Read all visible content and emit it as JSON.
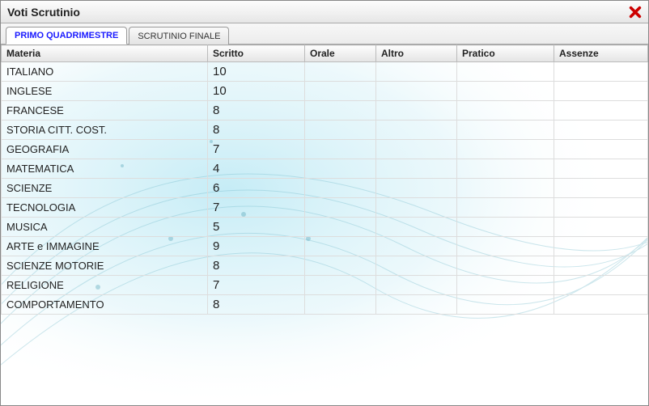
{
  "window": {
    "title": "Voti Scrutinio"
  },
  "tabs": [
    {
      "label": "PRIMO QUADRIMESTRE",
      "active": true
    },
    {
      "label": "SCRUTINIO FINALE",
      "active": false
    }
  ],
  "columns": {
    "materia": "Materia",
    "scritto": "Scritto",
    "orale": "Orale",
    "altro": "Altro",
    "pratico": "Pratico",
    "assenze": "Assenze"
  },
  "rows": [
    {
      "materia": "ITALIANO",
      "scritto": "10",
      "orale": "",
      "altro": "",
      "pratico": "",
      "assenze": ""
    },
    {
      "materia": "INGLESE",
      "scritto": "10",
      "orale": "",
      "altro": "",
      "pratico": "",
      "assenze": ""
    },
    {
      "materia": "FRANCESE",
      "scritto": "8",
      "orale": "",
      "altro": "",
      "pratico": "",
      "assenze": ""
    },
    {
      "materia": "STORIA CITT. COST.",
      "scritto": "8",
      "orale": "",
      "altro": "",
      "pratico": "",
      "assenze": ""
    },
    {
      "materia": "GEOGRAFIA",
      "scritto": "7",
      "orale": "",
      "altro": "",
      "pratico": "",
      "assenze": ""
    },
    {
      "materia": "MATEMATICA",
      "scritto": "4",
      "orale": "",
      "altro": "",
      "pratico": "",
      "assenze": ""
    },
    {
      "materia": "SCIENZE",
      "scritto": "6",
      "orale": "",
      "altro": "",
      "pratico": "",
      "assenze": ""
    },
    {
      "materia": "TECNOLOGIA",
      "scritto": "7",
      "orale": "",
      "altro": "",
      "pratico": "",
      "assenze": ""
    },
    {
      "materia": "MUSICA",
      "scritto": "5",
      "orale": "",
      "altro": "",
      "pratico": "",
      "assenze": ""
    },
    {
      "materia": "ARTE e IMMAGINE",
      "scritto": "9",
      "orale": "",
      "altro": "",
      "pratico": "",
      "assenze": ""
    },
    {
      "materia": "SCIENZE MOTORIE",
      "scritto": "8",
      "orale": "",
      "altro": "",
      "pratico": "",
      "assenze": ""
    },
    {
      "materia": "RELIGIONE",
      "scritto": "7",
      "orale": "",
      "altro": "",
      "pratico": "",
      "assenze": ""
    },
    {
      "materia": "COMPORTAMENTO",
      "scritto": "8",
      "orale": "",
      "altro": "",
      "pratico": "",
      "assenze": ""
    }
  ]
}
